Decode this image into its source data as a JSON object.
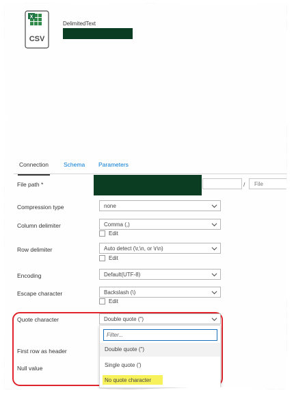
{
  "dataset": {
    "type_label": "DelimitedText",
    "icon_label": "CSV"
  },
  "tabs": [
    {
      "label": "Connection",
      "active": true
    },
    {
      "label": "Schema",
      "active": false
    },
    {
      "label": "Parameters",
      "active": false
    }
  ],
  "file_path": {
    "label": "File path *",
    "separator": "/",
    "file_placeholder": "File"
  },
  "compression": {
    "label": "Compression type",
    "value": "none"
  },
  "column_delimiter": {
    "label": "Column delimiter",
    "value": "Comma (,)",
    "edit_label": "Edit"
  },
  "row_delimiter": {
    "label": "Row delimiter",
    "value": "Auto detect (\\r,\\n, or \\r\\n)",
    "edit_label": "Edit"
  },
  "encoding": {
    "label": "Encoding",
    "value": "Default(UTF-8)"
  },
  "escape_character": {
    "label": "Escape character",
    "value": "Backslash (\\)",
    "edit_label": "Edit"
  },
  "quote_character": {
    "label": "Quote character",
    "value": "Double quote (\")",
    "filter_placeholder": "Filter...",
    "options": [
      "Double quote (\")",
      "Single quote (')",
      "No quote character"
    ]
  },
  "first_row_header": {
    "label": "First row as header"
  },
  "null_value": {
    "label": "Null value"
  },
  "colors": {
    "accent": "#0078d4",
    "highlight_border": "#e1232b",
    "highlight_fill": "#f7f15c",
    "redaction": "#0b3d23",
    "csv_icon_green": "#2f8a4a"
  }
}
